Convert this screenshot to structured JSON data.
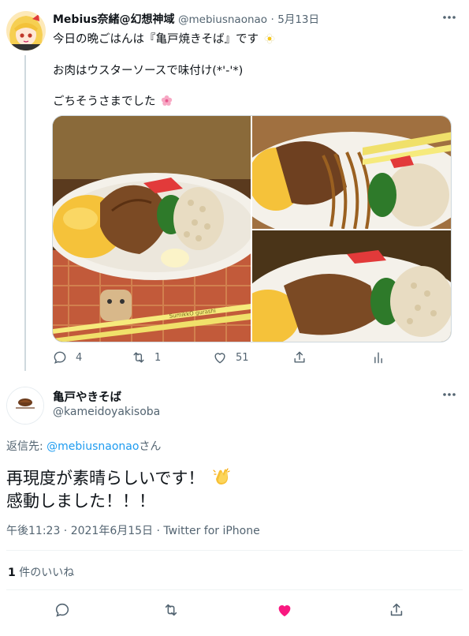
{
  "parent_tweet": {
    "display_name": "Mebius奈緒@幻想神域",
    "handle": "@mebiusnaonao",
    "separator": "·",
    "date": "5月13日",
    "lines": [
      "今日の晩ごはんは『亀戸焼きそば』です",
      "お肉はウスターソースで味付け(*'-'*)",
      "ごちそうさまでした"
    ],
    "chopstick_text": "SumikkO gurashi",
    "actions": {
      "reply_count": "4",
      "retweet_count": "1",
      "like_count": "51"
    }
  },
  "reply_tweet": {
    "display_name": "亀戸やきそば",
    "handle": "@kameidoyakisoba",
    "reply_prefix": "返信先: ",
    "reply_mention": "@mebiusnaonao",
    "reply_suffix": "さん",
    "lines": [
      "再現度が素晴らしいです！",
      "感動しました！！！"
    ],
    "timestamp": "午後11:23 · 2021年6月15日 · Twitter for iPhone",
    "likes_count": "1",
    "likes_label": " 件のいいね"
  },
  "colors": {
    "accent_blue": "#1d9bf0",
    "like_red": "#f91880",
    "secondary_text": "#536471"
  },
  "icons": [
    "more-icon",
    "reply-icon",
    "retweet-icon",
    "like-icon",
    "share-icon",
    "analytics-icon",
    "heart-filled-icon"
  ]
}
